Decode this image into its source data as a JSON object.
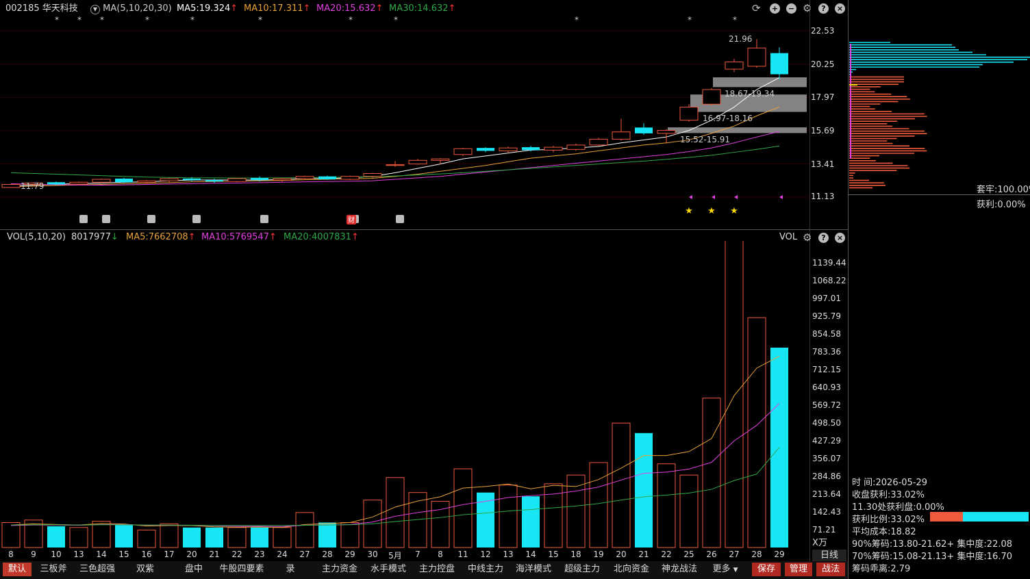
{
  "header": {
    "code": "002185",
    "name": "华天科技",
    "ma_toggle": "MA(5,10,20,30)",
    "ma5": "MA5:19.324",
    "ma10": "MA10:17.311",
    "ma20": "MA20:15.632",
    "ma30": "MA30:14.632",
    "arrow": "↑"
  },
  "colors": {
    "ma5": "#ffffff",
    "ma10": "#e8a33a",
    "ma20": "#e040e0",
    "ma30": "#2ea84a",
    "up": "#f05a3c",
    "down": "#19e6f5",
    "grid": "#3a0000"
  },
  "price_axis": [
    "22.53",
    "20.25",
    "17.97",
    "15.69",
    "13.41",
    "11.13"
  ],
  "annotations": {
    "high": "21.96",
    "low": "11.79",
    "band1": "18.67-19.34",
    "band2": "16.97-18.16",
    "band3": "15.52-15.91"
  },
  "volume_header": {
    "title": "VOL(5,10,20)",
    "value": "8017977",
    "ma5": "MA5:7662708",
    "ma10": "MA10:5769547",
    "ma20": "MA20:4007831",
    "right_label": "VOL",
    "unit": "X万"
  },
  "vol_axis": [
    "1139.44",
    "1068.22",
    "997.01",
    "925.79",
    "854.58",
    "783.36",
    "712.15",
    "640.93",
    "569.72",
    "498.50",
    "427.29",
    "356.07",
    "284.86",
    "213.64",
    "142.43",
    "71.21"
  ],
  "dates": [
    "8",
    "9",
    "10",
    "13",
    "14",
    "15",
    "16",
    "17",
    "20",
    "21",
    "22",
    "23",
    "24",
    "27",
    "28",
    "29",
    "30",
    "5月",
    "7",
    "8",
    "11",
    "12",
    "13",
    "14",
    "15",
    "18",
    "19",
    "20",
    "21",
    "22",
    "25",
    "26",
    "27",
    "28",
    "29"
  ],
  "period_label": "日线",
  "chip": {
    "trapped": "套牢:100.00%",
    "profit": "获利:0.00%",
    "time_label": "时      间:2026-05-29",
    "close_profit": "收盘获利:33.02%",
    "profit_at": "11.30处获利盘:0.00%",
    "profit_ratio": "获利比例:33.02%",
    "avg_cost": "平均成本:18.82",
    "c90": "90%筹码:13.80-21.62+ 集中度:22.08",
    "c70": "70%筹码:15.08-21.13+ 集中度:16.70",
    "deviation": "筹码乖离:2.79"
  },
  "tabs": [
    "默认",
    "三板斧",
    "三色超强",
    "双紫",
    "盘中",
    "牛股四要素",
    "录",
    "主力资金",
    "水手模式",
    "主力控盘",
    "中线主力",
    "海洋模式",
    "超级主力",
    "北向资金",
    "神龙战法",
    "更多"
  ],
  "right_buttons": [
    "保存",
    "管理",
    "战法"
  ],
  "event_icons": {
    "cai": "财"
  },
  "chart_data": {
    "type": "candlestick",
    "categories": [
      "8",
      "9",
      "10",
      "13",
      "14",
      "15",
      "16",
      "17",
      "20",
      "21",
      "22",
      "23",
      "24",
      "27",
      "28",
      "29",
      "30",
      "5月",
      "7",
      "8",
      "11",
      "12",
      "13",
      "14",
      "15",
      "18",
      "19",
      "20",
      "21",
      "22",
      "25",
      "26",
      "27",
      "28",
      "29"
    ],
    "price_axis_range": [
      11.13,
      22.53
    ],
    "ohlc": [
      [
        11.79,
        12.05,
        11.75,
        12.0
      ],
      [
        12.0,
        12.15,
        11.9,
        12.1
      ],
      [
        12.15,
        12.2,
        11.95,
        12.0
      ],
      [
        12.02,
        12.2,
        11.95,
        12.15
      ],
      [
        12.15,
        12.4,
        12.05,
        12.35
      ],
      [
        12.4,
        12.45,
        12.1,
        12.15
      ],
      [
        12.15,
        12.3,
        12.05,
        12.25
      ],
      [
        12.25,
        12.45,
        12.15,
        12.4
      ],
      [
        12.4,
        12.5,
        12.2,
        12.3
      ],
      [
        12.3,
        12.4,
        12.1,
        12.2
      ],
      [
        12.2,
        12.45,
        12.15,
        12.4
      ],
      [
        12.45,
        12.55,
        12.2,
        12.3
      ],
      [
        12.3,
        12.45,
        12.2,
        12.4
      ],
      [
        12.4,
        12.6,
        12.3,
        12.55
      ],
      [
        12.55,
        12.6,
        12.3,
        12.35
      ],
      [
        12.35,
        12.6,
        12.3,
        12.55
      ],
      [
        12.55,
        12.8,
        12.45,
        12.75
      ],
      [
        13.3,
        13.6,
        13.2,
        13.35
      ],
      [
        13.4,
        13.75,
        13.35,
        13.65
      ],
      [
        13.65,
        13.8,
        13.4,
        13.75
      ],
      [
        14.05,
        14.5,
        13.95,
        14.45
      ],
      [
        14.5,
        14.55,
        14.2,
        14.3
      ],
      [
        14.3,
        14.6,
        14.15,
        14.5
      ],
      [
        14.55,
        14.65,
        14.25,
        14.35
      ],
      [
        14.35,
        14.65,
        14.2,
        14.55
      ],
      [
        14.4,
        14.8,
        14.3,
        14.7
      ],
      [
        14.7,
        15.2,
        14.6,
        15.1
      ],
      [
        15.1,
        16.5,
        15.0,
        15.6
      ],
      [
        15.9,
        16.2,
        15.4,
        15.5
      ],
      [
        15.5,
        15.8,
        14.8,
        15.7
      ],
      [
        16.4,
        17.5,
        16.3,
        17.3
      ],
      [
        17.5,
        18.6,
        17.4,
        18.5
      ],
      [
        19.9,
        20.6,
        19.7,
        20.4
      ],
      [
        20.1,
        21.96,
        20.0,
        21.35
      ],
      [
        21.0,
        21.4,
        19.2,
        19.55
      ]
    ],
    "volume_unit": "万",
    "volume": [
      100,
      110,
      85,
      80,
      105,
      90,
      70,
      95,
      80,
      80,
      80,
      80,
      80,
      140,
      100,
      100,
      190,
      280,
      220,
      185,
      315,
      220,
      250,
      205,
      255,
      290,
      340,
      498,
      458,
      335,
      290,
      598,
      1230,
      920,
      800
    ],
    "series": [
      {
        "name": "MA5",
        "values": [
          11.9,
          11.95,
          12.02,
          12.05,
          12.1,
          12.15,
          12.18,
          12.25,
          12.3,
          12.3,
          12.3,
          12.3,
          12.33,
          12.4,
          12.4,
          12.45,
          12.55,
          12.8,
          13.1,
          13.4,
          13.75,
          13.95,
          14.15,
          14.35,
          14.4,
          14.5,
          14.6,
          14.85,
          15.05,
          15.25,
          15.7,
          16.4,
          17.3,
          18.5,
          19.32
        ]
      },
      {
        "name": "MA10",
        "values": [
          11.85,
          11.88,
          11.93,
          11.97,
          12.0,
          12.05,
          12.08,
          12.12,
          12.18,
          12.2,
          12.22,
          12.25,
          12.27,
          12.32,
          12.35,
          12.38,
          12.42,
          12.55,
          12.7,
          12.9,
          13.1,
          13.3,
          13.55,
          13.8,
          13.95,
          14.1,
          14.3,
          14.5,
          14.7,
          14.85,
          15.05,
          15.5,
          16.0,
          16.7,
          17.31
        ]
      },
      {
        "name": "MA20",
        "values": [
          12.05,
          12.0,
          11.98,
          11.96,
          11.95,
          11.97,
          12.0,
          12.03,
          12.05,
          12.08,
          12.1,
          12.12,
          12.15,
          12.18,
          12.2,
          12.22,
          12.25,
          12.35,
          12.45,
          12.55,
          12.7,
          12.85,
          13.0,
          13.15,
          13.3,
          13.45,
          13.6,
          13.75,
          13.9,
          14.05,
          14.25,
          14.5,
          14.85,
          15.25,
          15.63
        ]
      },
      {
        "name": "MA30",
        "values": [
          12.8,
          12.75,
          12.7,
          12.65,
          12.6,
          12.55,
          12.5,
          12.48,
          12.45,
          12.45,
          12.44,
          12.44,
          12.45,
          12.46,
          12.48,
          12.5,
          12.52,
          12.58,
          12.65,
          12.72,
          12.8,
          12.9,
          13.0,
          13.1,
          13.2,
          13.3,
          13.4,
          13.5,
          13.6,
          13.72,
          13.85,
          14.0,
          14.2,
          14.4,
          14.63
        ]
      }
    ],
    "volume_series": [
      {
        "name": "MA5",
        "values": [
          90,
          95,
          92,
          90,
          96,
          94,
          86,
          88,
          88,
          83,
          81,
          82,
          80,
          92,
          96,
          100,
          122,
          162,
          186,
          203,
          238,
          244,
          254,
          235,
          249,
          244,
          272,
          318,
          368,
          368,
          384,
          436,
          608,
          718,
          766
        ]
      },
      {
        "name": "MA10",
        "values": [
          88,
          90,
          90,
          89,
          92,
          92,
          89,
          90,
          89,
          87,
          85,
          85,
          84,
          89,
          90,
          92,
          102,
          125,
          140,
          152,
          172,
          185,
          200,
          208,
          214,
          226,
          242,
          270,
          297,
          302,
          314,
          341,
          427,
          489,
          577
        ]
      },
      {
        "name": "MA20",
        "values": [
          90,
          91,
          91,
          90,
          91,
          91,
          90,
          90,
          89,
          88,
          88,
          88,
          88,
          89,
          90,
          91,
          95,
          104,
          112,
          120,
          131,
          138,
          146,
          152,
          159,
          166,
          176,
          190,
          203,
          210,
          218,
          233,
          268,
          294,
          401
        ]
      }
    ]
  }
}
